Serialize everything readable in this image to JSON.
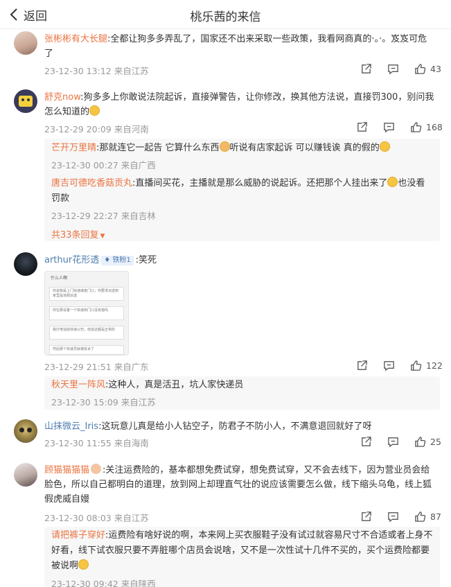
{
  "header": {
    "back_label": "返回",
    "title": "桃乐茜的来信"
  },
  "comments": [
    {
      "author": "张彬彬有大长腿",
      "text": "全都让狗多多弄乱了，国家还不出来采取一些政策，我看网商真的·。·。岌岌可危了",
      "time": "23-12-30 13:12 来自江苏",
      "likes": "43"
    },
    {
      "author": "舒克now",
      "text": "狗多多上你敢说法院起诉，直接弹警告，让你修改，换其他方法说，直接罚300，别问我怎么知道的",
      "time": "23-12-29 20:09 来自河南",
      "likes": "168",
      "replies": [
        {
          "author": "芒开万里晴",
          "text": "那就连它一起告 它算什么东西",
          "text2": "听说有店家起诉 可以赚钱诶 真的假的",
          "time": "23-12-30 00:27 来自广西"
        },
        {
          "author": "唐吉可德吃香菇贡丸",
          "text": "直播间买花，主播就是那么威胁的说起诉。还把那个人挂出来了",
          "text2": "也没看罚款",
          "time": "23-12-29 22:27 来自吉林"
        }
      ],
      "more_replies": "共33条回复"
    },
    {
      "author": "arthur花形透",
      "badge": "铁粉1",
      "text": ":笑死",
      "time": "23-12-29 21:51 来自广东",
      "likes": "122",
      "image_lines": [
        "什么人啊",
        "你说我是上门快递或者门口，你要求派送到家里是违规派送",
        "你在那设置一个快递到门口没有错吗",
        "我打电话给快递公司，他说这都是正常的",
        "然后那个快递员就被投诉了"
      ],
      "replies": [
        {
          "author": "秋天里一阵风",
          "text": "这种人，真是活丑，坑人家快递员",
          "time": "23-12-30 15:09 来自江苏"
        }
      ]
    },
    {
      "author": "山抹微云_Iris",
      "text": "这玩意儿真是给小人钻空子，防君子不防小人，不满意退回就好了呀",
      "time": "23-12-30 11:55 来自海南",
      "likes": "25"
    },
    {
      "author": "顾猫猫猫猫",
      "text": "关注运费险的，基本都想免费试穿，想免费试穿，又不会去线下，因为营业员会给脸色，所以自己都明白的道理，放到网上却理直气壮的说应该需要怎么做，线下缩头乌龟，线上狐假虎威自嫚",
      "time": "23-12-30 08:03 来自江苏",
      "likes": "87",
      "replies": [
        {
          "author": "请把裤子穿好",
          "text": "运费险有啥好说的啊，本来网上买衣服鞋子没有试过就容易尺寸不合适或者上身不好看，线下试衣服只要不弄脏哪个店员会说啥，又不是一次性试十几件不买的，买个运费险都要被说啊",
          "time": "23-12-30 09:42 来自陕西"
        }
      ]
    }
  ],
  "colors": {
    "name_orange": "#eb7340",
    "name_blue": "#507daf",
    "meta_gray": "#999999",
    "reply_bg": "#f7f7f7"
  }
}
